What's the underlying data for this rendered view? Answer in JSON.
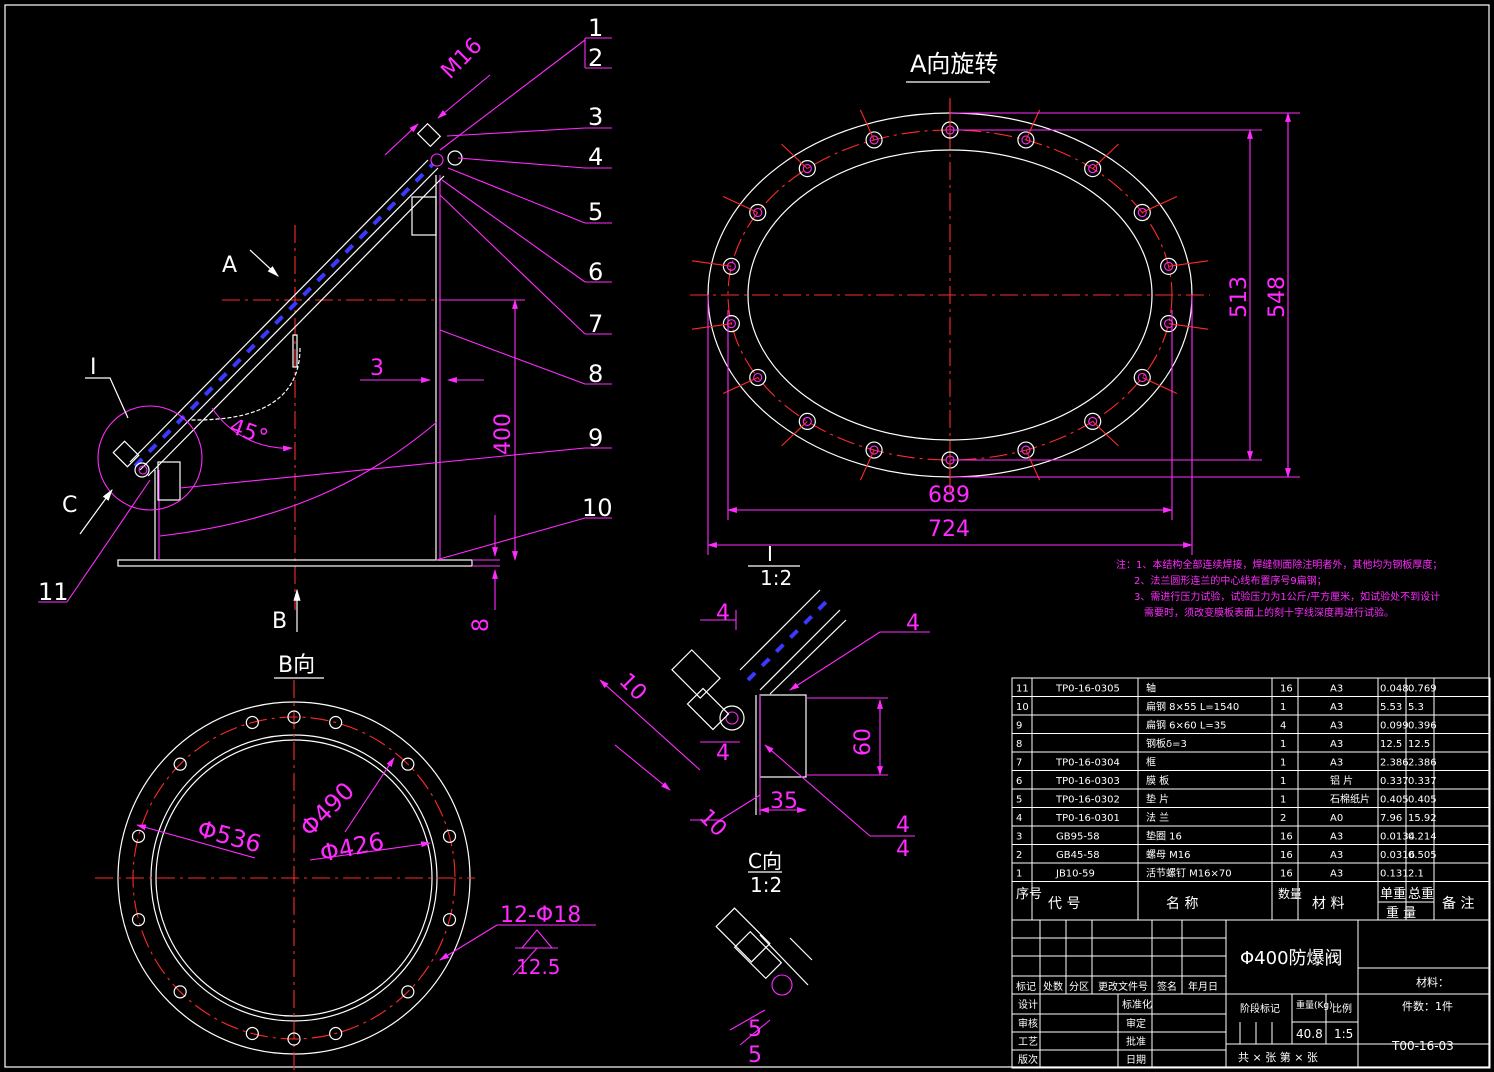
{
  "balloons": [
    "1",
    "2",
    "3",
    "4",
    "5",
    "6",
    "7",
    "8",
    "9",
    "10",
    "11"
  ],
  "views": {
    "main": {
      "thread": "M16",
      "angle": "45°",
      "thk": "3",
      "height": "400",
      "base": "8",
      "arrow_a": "A",
      "arrow_b": "B",
      "arrow_c": "C",
      "detail": "I"
    },
    "a_view": {
      "title": "A向旋转",
      "w_inner": "689",
      "w_outer": "724",
      "h_inner": "513",
      "h_outer": "548"
    },
    "b_view": {
      "title": "B向",
      "d1": "Φ536",
      "d2": "Φ490",
      "d3": "Φ426",
      "holes": "12-Φ18",
      "rough": "12.5"
    },
    "detail_i": {
      "title": "I",
      "scale": "1:2",
      "d10a": "10",
      "d10b": "10",
      "d4a": "4",
      "d4b": "4",
      "d4c": "4",
      "d4d": "4",
      "d60": "60",
      "d35": "35",
      "d4e": "4"
    },
    "detail_c": {
      "title": "C向",
      "scale": "1:2",
      "d5a": "5",
      "d5b": "5"
    }
  },
  "notes": [
    "注：1、本结构全部连续焊接，焊缝侧面除注明者外，其他均为钢板厚度；",
    "2、法兰圆形连兰的中心线布置序号9扁钢；",
    "3、需进行压力试验，试验压力为1公斤/平方厘米，如试验处不到设计",
    "需要时，须改变膜板表面上的刻十字线深度再进行试验。"
  ],
  "bom": {
    "rows": [
      [
        "11",
        "TP0-16-0305",
        "轴",
        "16",
        "A3",
        "0.048",
        "0.769",
        ""
      ],
      [
        "10",
        "",
        "扁钢 8×55 L=1540",
        "1",
        "A3",
        "5.53",
        "5.3",
        ""
      ],
      [
        "9",
        "",
        "扁钢 6×60 L=35",
        "4",
        "A3",
        "0.099",
        "0.396",
        ""
      ],
      [
        "8",
        "",
        "钢板δ=3",
        "1",
        "A3",
        "12.5",
        "12.5",
        ""
      ],
      [
        "7",
        "TP0-16-0304",
        "框",
        "1",
        "A3",
        "2.386",
        "2.386",
        ""
      ],
      [
        "6",
        "TP0-16-0303",
        "膜 板",
        "1",
        "铝 片",
        "0.337",
        "0.337",
        ""
      ],
      [
        "5",
        "TP0-16-0302",
        "垫 片",
        "1",
        "石棉纸片",
        "0.405",
        "0.405",
        ""
      ],
      [
        "4",
        "TP0-16-0301",
        "法 兰",
        "2",
        "A0",
        "7.96",
        "15.92",
        ""
      ],
      [
        "3",
        "GB95-58",
        "垫圈 16",
        "16",
        "A3",
        "0.0134",
        "0.214",
        ""
      ],
      [
        "2",
        "GB45-58",
        "螺母 M16",
        "16",
        "A3",
        "0.0316",
        "0.505",
        ""
      ],
      [
        "1",
        "JB10-59",
        "活节螺钉 M16×70",
        "16",
        "A3",
        "0.131",
        "2.1",
        ""
      ]
    ],
    "header": {
      "no": "序号",
      "code": "代 号",
      "name": "名 称",
      "qty": "数量",
      "mat": "材 料",
      "unit": "单重",
      "total": "总重",
      "weight": "重 量",
      "note": "备 注"
    }
  },
  "title_block": {
    "title": "Φ400防爆阀",
    "material": "材料：",
    "count": "件数：1件",
    "rev_labels": [
      "标记",
      "处数",
      "分区",
      "更改文件号",
      "签名",
      "年月日"
    ],
    "left_labels": [
      "设计",
      "审核",
      "工艺",
      "版次"
    ],
    "mid_labels": [
      "标准化",
      "审定",
      "批准",
      "日期"
    ],
    "stage": "阶段标记",
    "weight_label": "重量(Kg)",
    "scale_label": "比例",
    "weight": "40.8",
    "scale": "1:5",
    "drawing_no": "T00-16-03",
    "sheets": "共 × 张 第 × 张"
  }
}
